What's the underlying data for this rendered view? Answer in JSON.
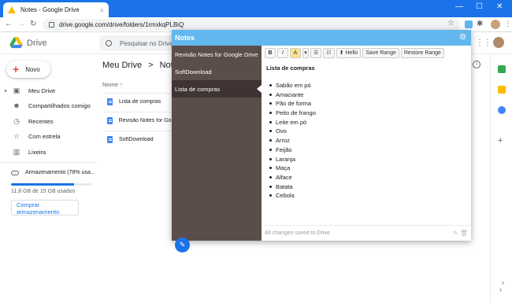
{
  "browser": {
    "tab_title": "Notes - Google Drive",
    "tab_close": "×",
    "new_tab": "+",
    "url": "drive.google.com/drive/folders/1rmxkqPLBiQ",
    "back": "←",
    "forward": "→",
    "reload": "↻",
    "minimize": "—",
    "maximize": "☐",
    "close": "✕",
    "star": "☆",
    "puzzle": "✱",
    "menu": "⋮"
  },
  "drive": {
    "title": "Drive",
    "search_placeholder": "Pesquisar no Drive",
    "apps": "⋮⋮",
    "new_button": "Novo",
    "new_plus": "+",
    "sidebar": [
      {
        "label": "Meu Drive",
        "icon": "drive-icon",
        "glyph": "▣"
      },
      {
        "label": "Compartilhados comigo",
        "icon": "people-icon",
        "glyph": "☻"
      },
      {
        "label": "Recentes",
        "icon": "clock-icon",
        "glyph": "◷"
      },
      {
        "label": "Com estrela",
        "icon": "star-icon",
        "glyph": "☆"
      },
      {
        "label": "Lixeira",
        "icon": "trash-icon",
        "glyph": "▥"
      }
    ],
    "sidebar_caret": "▸",
    "storage_label": "Armazenamento (78% usa...",
    "storage_fraction": 0.78,
    "storage_used": "11,8 GB de 15 GB usados",
    "buy_storage": "Comprar armazenamento",
    "breadcrumb": [
      "Meu Drive",
      ">",
      "Notes"
    ],
    "column_header": "Nome ↑",
    "files": [
      "Lista de compras",
      "Revisão Notes for Goo",
      "SoftDownload"
    ],
    "info": "i"
  },
  "notes_app": {
    "header": "Notes",
    "gear": "⚙",
    "notes": [
      "Revisão Notes for Google Drive",
      "SoftDownload",
      "Lista de compras"
    ],
    "active_index": 2,
    "fab": "✎",
    "toolbar": [
      "B",
      "I",
      "A",
      "▾",
      "☰",
      "☷",
      "⬆ Hello",
      "Save Range",
      "Restore Range"
    ],
    "note_title": "Lista de compras",
    "items": [
      "Sabão em pó",
      "Amaciante",
      "Pão de forma",
      "Peito de frango",
      "Leite em pó",
      "Ovo",
      "Arroz",
      "Feijão",
      "Laranja",
      "Maça",
      "Alface",
      "Batata",
      "Cebola"
    ],
    "footer": "All changes saved to Drive",
    "footer_icons": "✎ 🗑"
  },
  "colors": {
    "chrome_blue": "#1a73e8",
    "notes_header": "#62b7ee",
    "notes_list_bg": "#5b4d4a",
    "notes_active": "#3f3432"
  }
}
